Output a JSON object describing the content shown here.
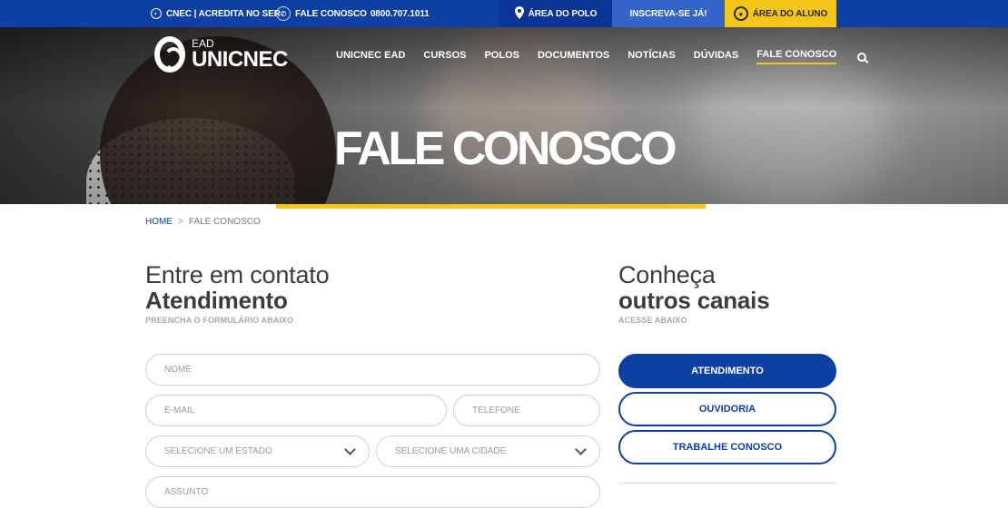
{
  "topbar": {
    "cnec": "CNEC | ACREDITA NO SER",
    "phone_label": "FALE CONOSCO",
    "phone_number": "0800.707.1011",
    "polo": "ÁREA DO POLO",
    "inscreva": "INSCREVA-SE JÁ!",
    "aluno": "ÁREA DO ALUNO"
  },
  "logo": {
    "small": "EAD",
    "big": "UNICNEC"
  },
  "nav": {
    "items": [
      "UNICNEC EAD",
      "CURSOS",
      "POLOS",
      "DOCUMENTOS",
      "NOTÍCIAS",
      "DÚVIDAS",
      "FALE CONOSCO"
    ],
    "active": "FALE CONOSCO"
  },
  "hero": {
    "title": "FALE CONOSCO"
  },
  "breadcrumb": {
    "home": "HOME",
    "separator": ">",
    "current": "FALE CONOSCO"
  },
  "contact": {
    "heading_light": "Entre em contato",
    "heading_bold": "Atendimento",
    "subtitle": "PREENCHA O FORMULÁRIO ABAIXO",
    "fields": {
      "name_placeholder": "NOME",
      "email_placeholder": "E-MAIL",
      "phone_placeholder": "TELEFONE",
      "state_select": "SELECIONE UM ESTADO",
      "city_select": "SELECIONE UMA CIDADE",
      "subject_placeholder": "ASSUNTO"
    }
  },
  "channels": {
    "heading_light": "Conheça",
    "heading_bold": "outros canais",
    "subtitle": "ACESSE ABAIXO",
    "buttons": [
      "ATENDIMENTO",
      "OUVIDORIA",
      "TRABALHE CONOSCO"
    ]
  },
  "colors": {
    "brand_blue": "#0e3fa3",
    "accent_yellow": "#f5c518"
  }
}
